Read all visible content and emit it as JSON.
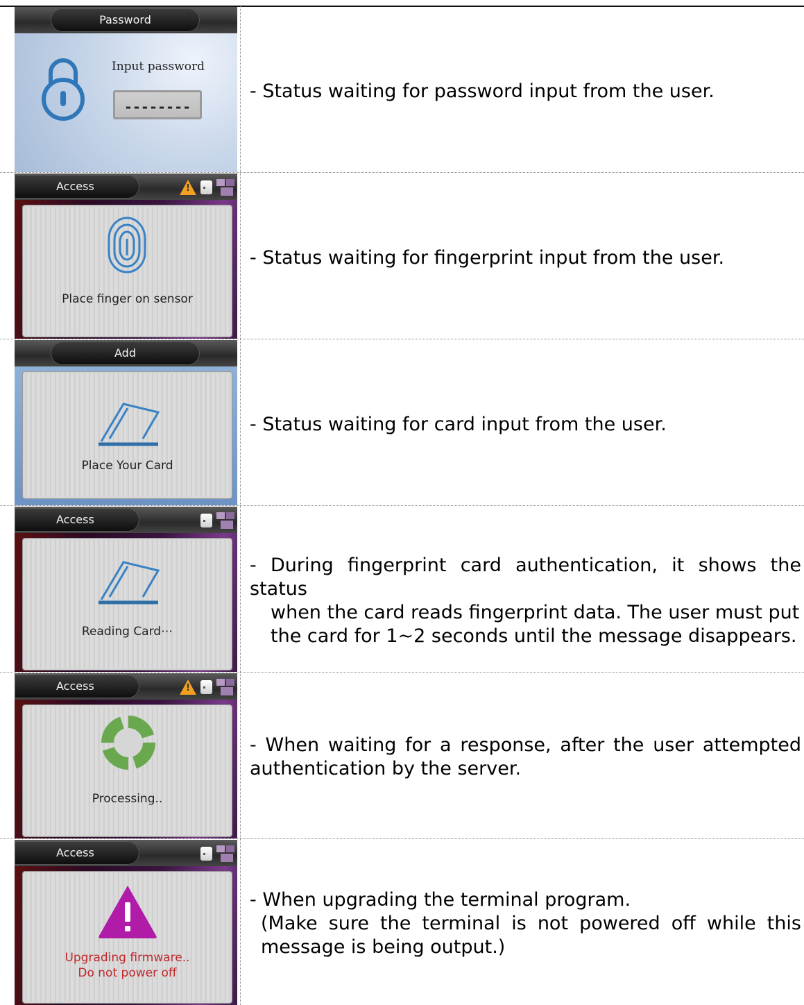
{
  "rows": [
    {
      "screen_title": "Password",
      "screen_text": "Input password",
      "password_field": "--------",
      "description": "- Status waiting for password input from the user."
    },
    {
      "screen_title": "Access",
      "screen_text": "Place finger on sensor",
      "description": "- Status waiting for fingerprint input from the user."
    },
    {
      "screen_title": "Add",
      "screen_text": "Place Your Card",
      "description": "- Status waiting for card input from the user."
    },
    {
      "screen_title": "Access",
      "screen_text": "Reading Card⋯",
      "description_line1": "- During fingerprint card authentication, it shows the status",
      "description_line2": "when the card reads fingerprint data. The user must put",
      "description_line3": "the card for 1~2 seconds until the message disappears."
    },
    {
      "screen_title": "Access",
      "screen_text": "Processing..",
      "description_line1": "- When waiting for a response, after the user attempted",
      "description_line2": "authentication by the server."
    },
    {
      "screen_title": "Access",
      "screen_text_line1": "Upgrading firmware..",
      "screen_text_line2": "Do not power off",
      "description_line1": "- When upgrading the terminal program.",
      "description_line2": "(Make sure the terminal is not powered off while this",
      "description_line3": "message is being output.)"
    }
  ],
  "colors": {
    "warning_icon": "#f2a021",
    "fingerprint_icon": "#3a82c4",
    "card_icon": "#3a82c4",
    "processing_icon": "#6aa84f",
    "alert_icon": "#b01ca8",
    "alert_text": "#c0282b"
  },
  "icons": [
    "lock-icon",
    "warning-icon",
    "card-status-icon",
    "network-icon",
    "fingerprint-icon",
    "card-icon",
    "processing-icon",
    "alert-icon"
  ]
}
